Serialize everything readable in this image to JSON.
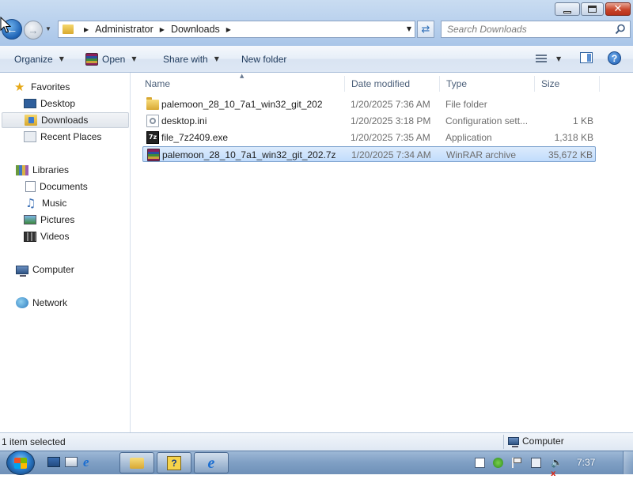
{
  "window": {
    "minimize_label": "",
    "maximize_label": "",
    "close_label": "✕"
  },
  "address": {
    "crumbs": [
      "Administrator",
      "Downloads"
    ]
  },
  "search": {
    "placeholder": "Search Downloads"
  },
  "toolbar": {
    "organize": "Organize",
    "open": "Open",
    "share_with": "Share with",
    "new_folder": "New folder"
  },
  "nav": {
    "favorites": "Favorites",
    "desktop": "Desktop",
    "downloads": "Downloads",
    "recent_places": "Recent Places",
    "libraries": "Libraries",
    "documents": "Documents",
    "music": "Music",
    "pictures": "Pictures",
    "videos": "Videos",
    "computer": "Computer",
    "network": "Network"
  },
  "columns": {
    "name": "Name",
    "date_modified": "Date modified",
    "type": "Type",
    "size": "Size"
  },
  "files": [
    {
      "name": "palemoon_28_10_7a1_win32_git_202",
      "date": "1/20/2025 7:36 AM",
      "type": "File folder",
      "size": "",
      "icon": "folder-icon"
    },
    {
      "name": "desktop.ini",
      "date": "1/20/2025 3:18 PM",
      "type": "Configuration sett...",
      "size": "1 KB",
      "icon": "config-file-icon"
    },
    {
      "name": "file_7z2409.exe",
      "date": "1/20/2025 7:35 AM",
      "type": "Application",
      "size": "1,318 KB",
      "icon": "7zip-icon"
    },
    {
      "name": "palemoon_28_10_7a1_win32_git_202.7z",
      "date": "1/20/2025 7:34 AM",
      "type": "WinRAR archive",
      "size": "35,672 KB",
      "icon": "winrar-archive-icon"
    }
  ],
  "selected_file_index": 3,
  "status": {
    "selection": "1 item selected",
    "location": "Computer"
  },
  "taskbar": {
    "help_glyph": "?",
    "ie_glyph": "e",
    "clock": "7:37"
  }
}
